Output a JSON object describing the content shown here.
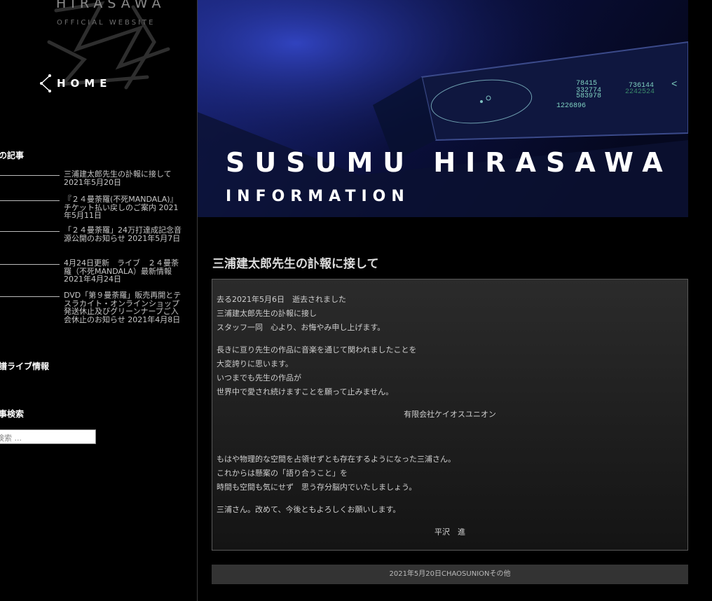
{
  "site": {
    "name": "HIRASAWA",
    "subtitle": "OFFICIAL WEBSITE",
    "home_label": "HOME"
  },
  "sidebar": {
    "recent_title": "近の記事",
    "recent_posts": [
      "三浦建太郎先生の訃報に接して 2021年5月20日",
      "『２４曼荼羅(不死MANDALA)』チケット払い戻しのご案内 2021年5月11日",
      "「２４曼荼羅」24万打達成記念音源公開のお知らせ 2021年5月7日",
      "4月24日更新　ライブ　２４曼荼羅（不死MANDALA）最新情報 2021年4月24日",
      "DVD「第９曼荼羅」販売再開とテスラカイト・オンラインショップ発送休止及びグリーンナープご入会休止のお知らせ 2021年4月8日"
    ],
    "live_title": "新譜ライブ情報",
    "search_title": "記事検索",
    "search_placeholder": "検索 ..."
  },
  "hero": {
    "title": "SUSUMU HIRASAWA",
    "subtitle": "INFORMATION",
    "screen_numbers": [
      "78415",
      "332774",
      "583978",
      "736144",
      "2242524",
      "1226896",
      "<"
    ]
  },
  "post": {
    "title": "三浦建太郎先生の訃報に接して",
    "lines": [
      "去る2021年5月6日　逝去されました",
      "三浦建太郎先生の訃報に接し",
      "スタッフ一同　心より、お悔やみ申し上げます。",
      "長きに亘り先生の作品に音楽を通じて関われましたことを",
      "大変誇りに思います。",
      "いつまでも先生の作品が",
      "世界中で愛され続けますことを願って止みません。",
      "有限会社ケイオスユニオン",
      "もはや物理的な空間を占領せずとも存在するようになった三浦さん。",
      "これからは懸案の「語り合うこと」を",
      "時間も空間も気にせず　思う存分脳内でいたしましょう。",
      "三浦さん。改めて、今後ともよろしくお願いします。",
      "平沢　進"
    ],
    "meta": "2021年5月20日CHAOSUNIONその他"
  },
  "colors": {
    "background": "#000000",
    "content_box_top": "#2b2b2b",
    "hero_blue": "#0c1142",
    "meta_bar": "#333333"
  }
}
